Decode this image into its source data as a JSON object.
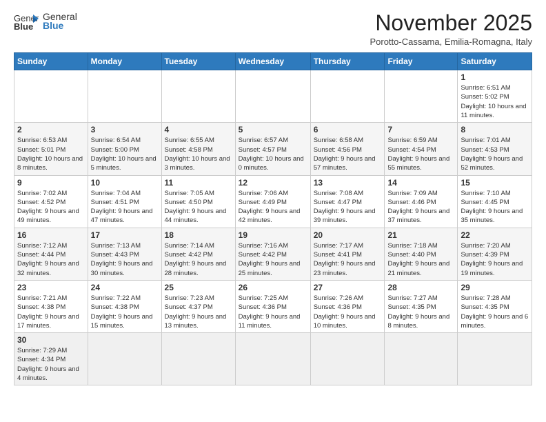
{
  "logo": {
    "line1": "General",
    "line2": "Blue"
  },
  "title": "November 2025",
  "location": "Porotto-Cassama, Emilia-Romagna, Italy",
  "days_of_week": [
    "Sunday",
    "Monday",
    "Tuesday",
    "Wednesday",
    "Thursday",
    "Friday",
    "Saturday"
  ],
  "weeks": [
    [
      {
        "day": "",
        "info": ""
      },
      {
        "day": "",
        "info": ""
      },
      {
        "day": "",
        "info": ""
      },
      {
        "day": "",
        "info": ""
      },
      {
        "day": "",
        "info": ""
      },
      {
        "day": "",
        "info": ""
      },
      {
        "day": "1",
        "info": "Sunrise: 6:51 AM\nSunset: 5:02 PM\nDaylight: 10 hours\nand 11 minutes."
      }
    ],
    [
      {
        "day": "2",
        "info": "Sunrise: 6:53 AM\nSunset: 5:01 PM\nDaylight: 10 hours\nand 8 minutes."
      },
      {
        "day": "3",
        "info": "Sunrise: 6:54 AM\nSunset: 5:00 PM\nDaylight: 10 hours\nand 5 minutes."
      },
      {
        "day": "4",
        "info": "Sunrise: 6:55 AM\nSunset: 4:58 PM\nDaylight: 10 hours\nand 3 minutes."
      },
      {
        "day": "5",
        "info": "Sunrise: 6:57 AM\nSunset: 4:57 PM\nDaylight: 10 hours\nand 0 minutes."
      },
      {
        "day": "6",
        "info": "Sunrise: 6:58 AM\nSunset: 4:56 PM\nDaylight: 9 hours\nand 57 minutes."
      },
      {
        "day": "7",
        "info": "Sunrise: 6:59 AM\nSunset: 4:54 PM\nDaylight: 9 hours\nand 55 minutes."
      },
      {
        "day": "8",
        "info": "Sunrise: 7:01 AM\nSunset: 4:53 PM\nDaylight: 9 hours\nand 52 minutes."
      }
    ],
    [
      {
        "day": "9",
        "info": "Sunrise: 7:02 AM\nSunset: 4:52 PM\nDaylight: 9 hours\nand 49 minutes."
      },
      {
        "day": "10",
        "info": "Sunrise: 7:04 AM\nSunset: 4:51 PM\nDaylight: 9 hours\nand 47 minutes."
      },
      {
        "day": "11",
        "info": "Sunrise: 7:05 AM\nSunset: 4:50 PM\nDaylight: 9 hours\nand 44 minutes."
      },
      {
        "day": "12",
        "info": "Sunrise: 7:06 AM\nSunset: 4:49 PM\nDaylight: 9 hours\nand 42 minutes."
      },
      {
        "day": "13",
        "info": "Sunrise: 7:08 AM\nSunset: 4:47 PM\nDaylight: 9 hours\nand 39 minutes."
      },
      {
        "day": "14",
        "info": "Sunrise: 7:09 AM\nSunset: 4:46 PM\nDaylight: 9 hours\nand 37 minutes."
      },
      {
        "day": "15",
        "info": "Sunrise: 7:10 AM\nSunset: 4:45 PM\nDaylight: 9 hours\nand 35 minutes."
      }
    ],
    [
      {
        "day": "16",
        "info": "Sunrise: 7:12 AM\nSunset: 4:44 PM\nDaylight: 9 hours\nand 32 minutes."
      },
      {
        "day": "17",
        "info": "Sunrise: 7:13 AM\nSunset: 4:43 PM\nDaylight: 9 hours\nand 30 minutes."
      },
      {
        "day": "18",
        "info": "Sunrise: 7:14 AM\nSunset: 4:42 PM\nDaylight: 9 hours\nand 28 minutes."
      },
      {
        "day": "19",
        "info": "Sunrise: 7:16 AM\nSunset: 4:42 PM\nDaylight: 9 hours\nand 25 minutes."
      },
      {
        "day": "20",
        "info": "Sunrise: 7:17 AM\nSunset: 4:41 PM\nDaylight: 9 hours\nand 23 minutes."
      },
      {
        "day": "21",
        "info": "Sunrise: 7:18 AM\nSunset: 4:40 PM\nDaylight: 9 hours\nand 21 minutes."
      },
      {
        "day": "22",
        "info": "Sunrise: 7:20 AM\nSunset: 4:39 PM\nDaylight: 9 hours\nand 19 minutes."
      }
    ],
    [
      {
        "day": "23",
        "info": "Sunrise: 7:21 AM\nSunset: 4:38 PM\nDaylight: 9 hours\nand 17 minutes."
      },
      {
        "day": "24",
        "info": "Sunrise: 7:22 AM\nSunset: 4:38 PM\nDaylight: 9 hours\nand 15 minutes."
      },
      {
        "day": "25",
        "info": "Sunrise: 7:23 AM\nSunset: 4:37 PM\nDaylight: 9 hours\nand 13 minutes."
      },
      {
        "day": "26",
        "info": "Sunrise: 7:25 AM\nSunset: 4:36 PM\nDaylight: 9 hours\nand 11 minutes."
      },
      {
        "day": "27",
        "info": "Sunrise: 7:26 AM\nSunset: 4:36 PM\nDaylight: 9 hours\nand 10 minutes."
      },
      {
        "day": "28",
        "info": "Sunrise: 7:27 AM\nSunset: 4:35 PM\nDaylight: 9 hours\nand 8 minutes."
      },
      {
        "day": "29",
        "info": "Sunrise: 7:28 AM\nSunset: 4:35 PM\nDaylight: 9 hours\nand 6 minutes."
      }
    ],
    [
      {
        "day": "30",
        "info": "Sunrise: 7:29 AM\nSunset: 4:34 PM\nDaylight: 9 hours\nand 4 minutes."
      },
      {
        "day": "",
        "info": ""
      },
      {
        "day": "",
        "info": ""
      },
      {
        "day": "",
        "info": ""
      },
      {
        "day": "",
        "info": ""
      },
      {
        "day": "",
        "info": ""
      },
      {
        "day": "",
        "info": ""
      }
    ]
  ]
}
